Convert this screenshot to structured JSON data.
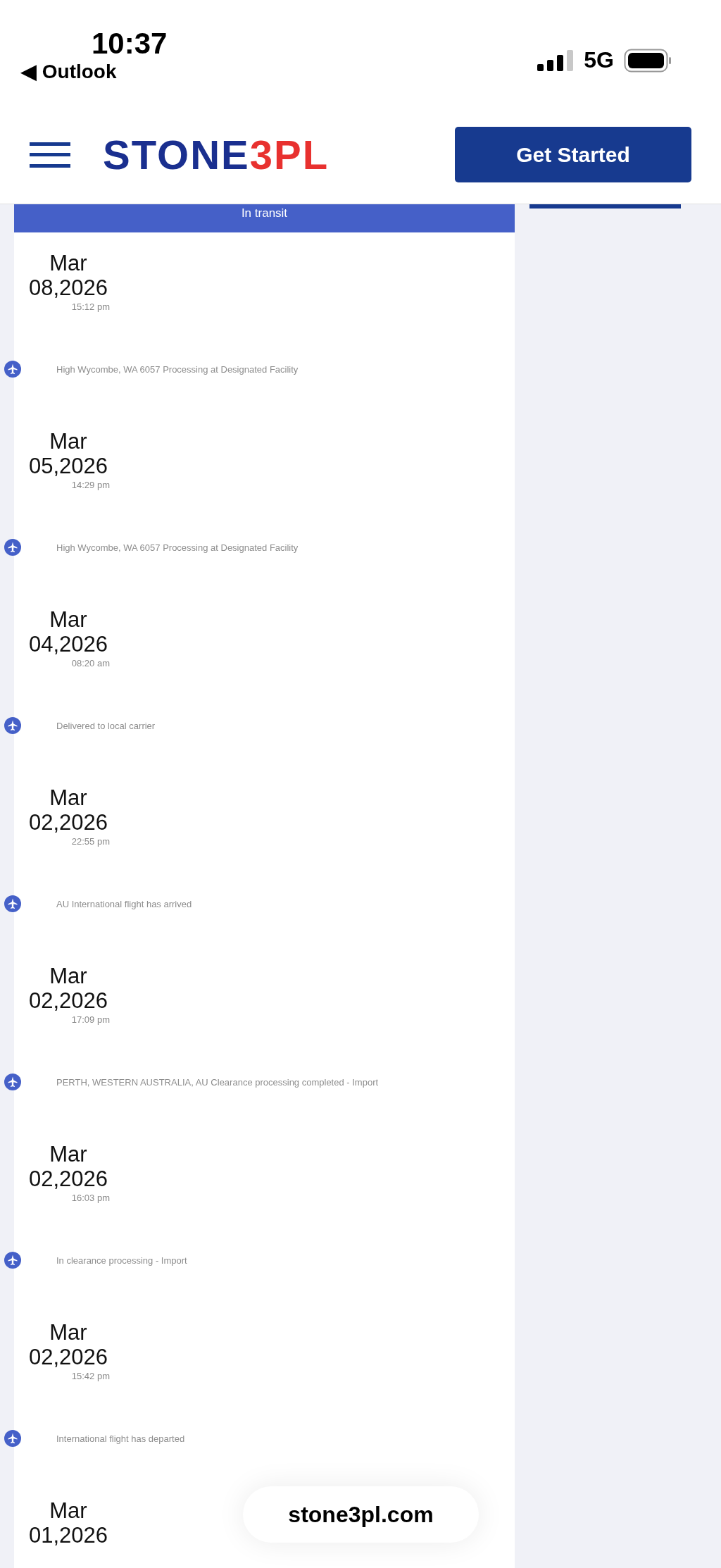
{
  "status_bar": {
    "time": "10:37",
    "back_label": "◀ Outlook",
    "network": "5G"
  },
  "header": {
    "logo": {
      "text": "STONE",
      "accent": "3PL"
    },
    "button": "Get Started"
  },
  "status_banner": "In transit",
  "events": [
    {
      "date": "Mar 08,2026",
      "time": "15:12 pm",
      "description": "High Wycombe, WA 6057 Processing at Designated Facility"
    },
    {
      "date": "Mar 05,2026",
      "time": "14:29 pm",
      "description": "High Wycombe, WA 6057 Processing at Designated Facility"
    },
    {
      "date": "Mar 04,2026",
      "time": "08:20 am",
      "description": "Delivered to local carrier"
    },
    {
      "date": "Mar 02,2026",
      "time": "22:55 pm",
      "description": "AU International flight has arrived"
    },
    {
      "date": "Mar 02,2026",
      "time": "17:09 pm",
      "description": "PERTH, WESTERN AUSTRALIA, AU Clearance processing completed - Import"
    },
    {
      "date": "Mar 02,2026",
      "time": "16:03 pm",
      "description": "In clearance processing - Import"
    },
    {
      "date": "Mar 02,2026",
      "time": "15:42 pm",
      "description": "International flight has departed"
    },
    {
      "date": "Mar 01,2026"
    }
  ],
  "url_bar": "stone3pl.com"
}
